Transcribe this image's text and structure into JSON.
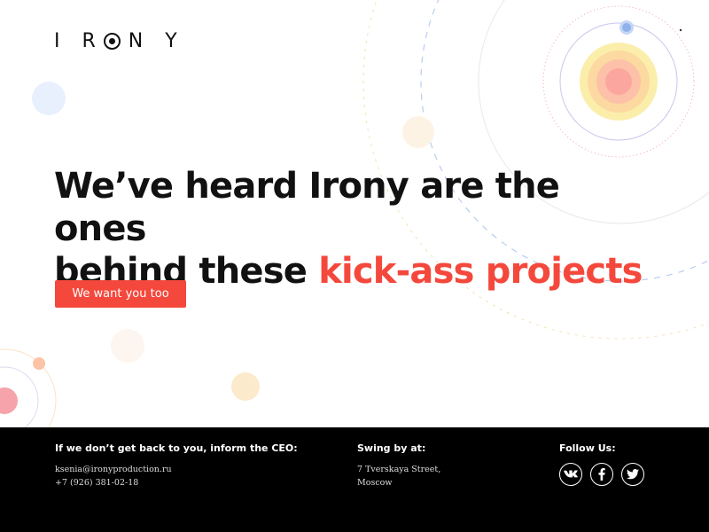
{
  "brand": {
    "logo_left": "I R",
    "logo_right": "N Y"
  },
  "hero": {
    "headline_line1": "We’ve heard Irony are the ones",
    "headline_line2_plain": "behind these ",
    "headline_line2_accent": "kick-ass projects",
    "cta_label": "We want you too"
  },
  "footer": {
    "contact_title": "If we don’t get back to you, inform the CEO:",
    "email": "ksenia@ironyproduction.ru",
    "phone": "+7 (926) 381-02-18",
    "address_title": "Swing by at:",
    "address_line1": "7 Tverskaya Street,",
    "address_line2": "Moscow",
    "follow_title": "Follow Us:",
    "social": [
      {
        "name": "vk-icon",
        "glyph": "vk"
      },
      {
        "name": "facebook-icon",
        "glyph": "f"
      },
      {
        "name": "twitter-icon",
        "glyph": "t"
      }
    ]
  },
  "colors": {
    "accent": "#f4483c",
    "footer_bg": "#000000",
    "text": "#111111"
  }
}
